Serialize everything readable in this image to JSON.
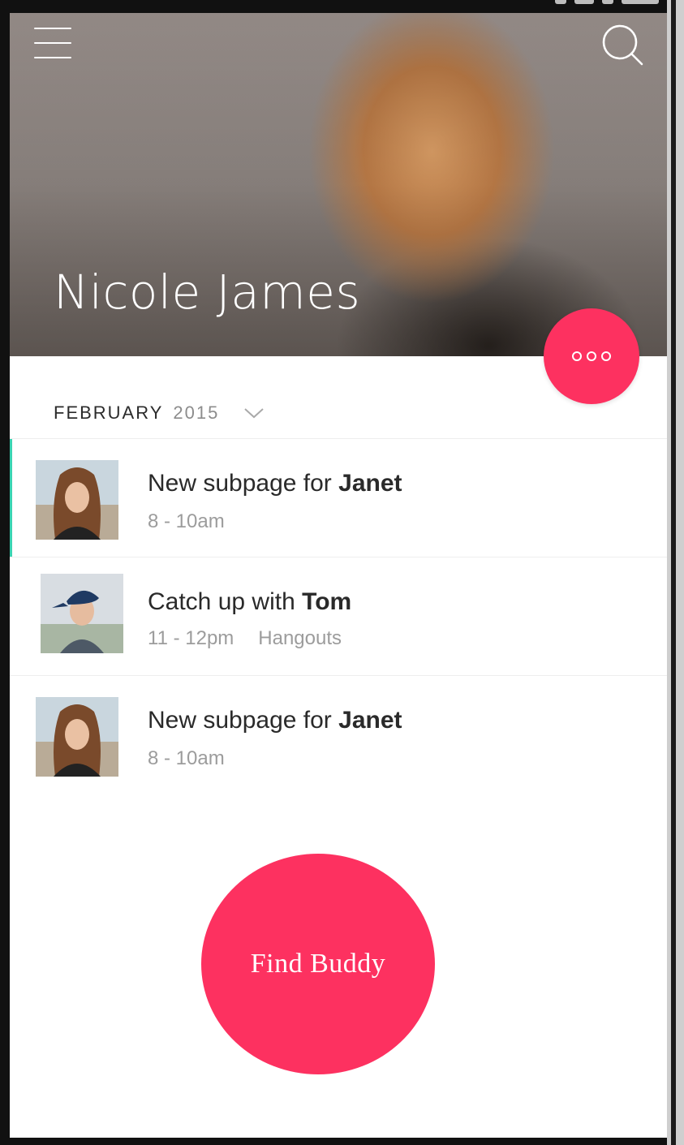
{
  "profile": {
    "name": "Nicole James"
  },
  "header": {
    "menu_icon": "hamburger-menu-icon",
    "search_icon": "search-icon",
    "more_icon": "more-dots-icon"
  },
  "calendar": {
    "month": "FEBRUARY",
    "year": "2015",
    "dropdown_icon": "chevron-down-icon"
  },
  "agenda": [
    {
      "title_prefix": "New subpage for",
      "title_name": "Janet",
      "time": "8 - 10am",
      "location": "",
      "avatar": "janet-avatar"
    },
    {
      "title_prefix": "Catch up with",
      "title_name": "Tom",
      "time": "11 - 12pm",
      "location": "Hangouts",
      "avatar": "tom-avatar"
    },
    {
      "title_prefix": "New subpage for",
      "title_name": "Janet",
      "time": "8 - 10am",
      "location": "",
      "avatar": "janet-avatar"
    }
  ],
  "actions": {
    "find_buddy": "Find Buddy"
  },
  "colors": {
    "accent": "#fd3160",
    "active_indicator": "#39d3b1",
    "text_primary": "#2a2a2a",
    "text_muted": "#9c9c9c"
  }
}
